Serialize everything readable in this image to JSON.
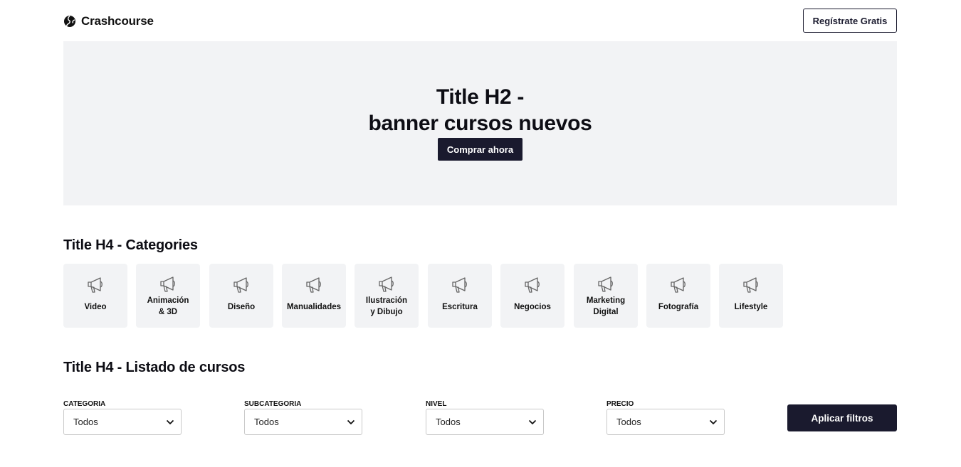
{
  "header": {
    "logo_text": "Crashcourse",
    "register_label": "Regístrate Gratis"
  },
  "banner": {
    "title_line1": "Title H2 -",
    "title_line2": "banner cursos nuevos",
    "cta_label": "Comprar ahora"
  },
  "categories_section": {
    "title": "Title H4 - Categories",
    "items": [
      {
        "line1": "Video",
        "line2": "",
        "icon": "megaphone-icon"
      },
      {
        "line1": "Animación",
        "line2": "& 3D",
        "icon": "megaphone-icon"
      },
      {
        "line1": "Diseño",
        "line2": "",
        "icon": "megaphone-icon"
      },
      {
        "line1": "Manualidades",
        "line2": "",
        "icon": "megaphone-icon"
      },
      {
        "line1": "Ilustración",
        "line2": "y Dibujo",
        "icon": "megaphone-icon"
      },
      {
        "line1": "Escritura",
        "line2": "",
        "icon": "megaphone-icon"
      },
      {
        "line1": "Negocios",
        "line2": "",
        "icon": "megaphone-icon"
      },
      {
        "line1": "Marketing",
        "line2": "Digital",
        "icon": "megaphone-icon"
      },
      {
        "line1": "Fotografía",
        "line2": "",
        "icon": "megaphone-icon"
      },
      {
        "line1": "Lifestyle",
        "line2": "",
        "icon": "megaphone-icon"
      }
    ]
  },
  "courses_section": {
    "title": "Title H4 - Listado de cursos",
    "filters": [
      {
        "label": "CATEGORIA",
        "value": "Todos"
      },
      {
        "label": "SUBCATEGORIA",
        "value": "Todos"
      },
      {
        "label": "NIVEL",
        "value": "Todos"
      },
      {
        "label": "PRECIO",
        "value": "Todos"
      }
    ],
    "apply_label": "Aplicar filtros"
  },
  "colors": {
    "primary": "#1a1a2e",
    "surface": "#f2f3f5",
    "text": "#0d0d14"
  }
}
